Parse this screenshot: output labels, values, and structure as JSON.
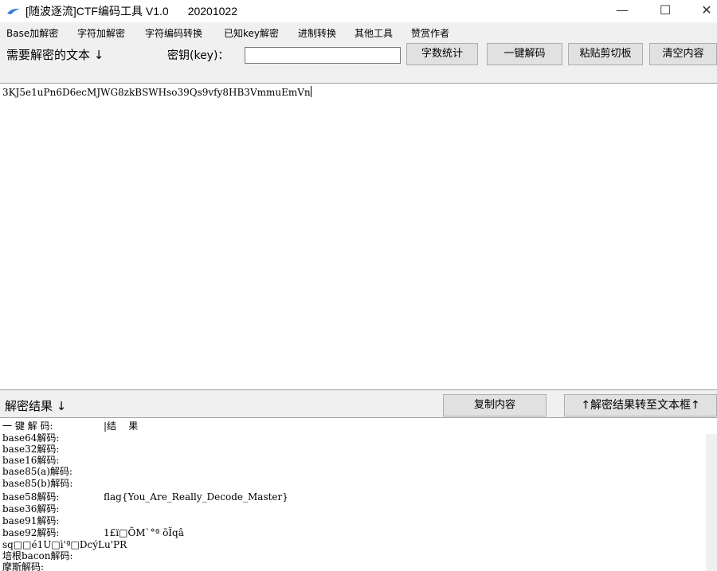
{
  "window": {
    "title": "[随波逐流]CTF编码工具 V1.0",
    "version_date": "20201022",
    "minimize": "—",
    "maximize": "☐",
    "close": "✕"
  },
  "menu": [
    "Base加解密",
    "字符加解密",
    "字符编码转换",
    "已知key解密",
    "进制转换",
    "其他工具",
    "赞赏作者"
  ],
  "toolbar": {
    "source_label": "需要解密的文本 ↓",
    "key_label": "密钥(key)：",
    "key_value": "",
    "count_button": "字数统计",
    "decode_button": "一键解码",
    "paste_button": "粘贴剪切板",
    "clear_button": "清空内容"
  },
  "input": {
    "text": "3KJ5e1uPn6D6ecMJWG8zkBSWHso39Qs9vfy8HB3VmmuEmVn"
  },
  "result_bar": {
    "label": "解密结果 ↓",
    "copy_button": "复制内容",
    "transfer_button": "↑解密结果转至文本框↑"
  },
  "output": {
    "header_left": "一 键 解 码:",
    "header_right": "|结    果",
    "rows": [
      {
        "label": "base64解码:",
        "value": ""
      },
      {
        "label": "base32解码:",
        "value": ""
      },
      {
        "label": "base16解码:",
        "value": ""
      },
      {
        "label": "base85(a)解码:",
        "value": ""
      },
      {
        "label": "base85(b)解码:",
        "value": ""
      },
      {
        "label": "base58解码:",
        "value": "flag{You_Are_Really_Decode_Master}"
      },
      {
        "label": "base36解码:",
        "value": ""
      },
      {
        "label": "base91解码:",
        "value": ""
      },
      {
        "label": "base92解码:",
        "value": "1£ï□ÕM`°ª õÏqâ"
      },
      {
        "label": "sq□□é1U□ì'ª□DcýLu'PR",
        "value": ""
      },
      {
        "label": "培根bacon解码:",
        "value": ""
      },
      {
        "label": "摩斯解码:",
        "value": ""
      }
    ]
  },
  "colors": {
    "window_bg": "#f0f0f0",
    "text_bg": "#ffffff",
    "button_bg": "#e1e1e1",
    "border": "#adadad"
  }
}
